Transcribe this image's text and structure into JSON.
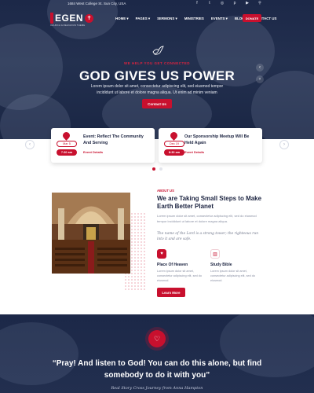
{
  "topbar": {
    "address": "1684 West College St. Sun City, USA",
    "social_icons": [
      "facebook-icon",
      "twitter-icon",
      "instagram-icon",
      "pinterest-icon",
      "youtube-icon",
      "search-icon"
    ],
    "social_glyphs": [
      "f",
      "t",
      "◎",
      "p",
      "▶",
      "⚲"
    ]
  },
  "brand": {
    "name": "EGEN",
    "tagline": "CHURCH & RELIGIOUS THEME"
  },
  "nav": {
    "items": [
      "HOME ▾",
      "PAGES ▾",
      "SERMONS ▾",
      "MINISTRIES",
      "EVENTS ▾",
      "BLOG ▾",
      "CONTACT US"
    ],
    "donate": "DONATE"
  },
  "hero": {
    "pre_title": "WE HELP YOU GET CONNECTED",
    "title": "GOD GIVES US POWER",
    "subtitle": "Lorem ipsum dolor sit amet, consectetur adipiscing elit, sed eiusmod tempor incididunt ut labore et dolore magna aliqua. Ut enim ad minim veniam",
    "button": "Contact Us",
    "arrow_up": "‹",
    "arrow_down": "›"
  },
  "events": [
    {
      "date": "Mar 5",
      "time": "7:30 am",
      "title": "Event: Reflect The Community And Serving",
      "link": "Event Details"
    },
    {
      "date": "Dec 19",
      "time": "8:30 am",
      "title": "Our Sponsorship Meetup Will Be Held Again",
      "link": "Event Details"
    }
  ],
  "events_nav": {
    "prev": "‹",
    "next": "›"
  },
  "about": {
    "tag": "ABOUT US",
    "title": "We are Taking Small Steps to Make Earth Better Planet",
    "body": "Lorem ipsum dolor sit amet, consectetur adipiscing elit, sed do eiusmod tempor incididunt ut labore et dolore magna aliqua.",
    "quote": "The name of the Lord is a strong tower; the righteous run into it and are safe.",
    "features": [
      {
        "icon": "heart-icon",
        "title": "Place Of Heaven",
        "body": "Lorem ipsum dolor sit amet, consectetur adipiscing elit, sed do eiusmod."
      },
      {
        "icon": "bible-icon",
        "title": "Study Bible",
        "body": "Lorem ipsum dolor sit amet, consectetur adipiscing elit, sed do eiusmod."
      }
    ],
    "button": "Learn More"
  },
  "testimonial": {
    "quote": "“Pray! And listen to God! You can do this alone, but find somebody to do it with you”",
    "author": "Real Story Cross Journey from Anna Hampton"
  },
  "colors": {
    "accent": "#c8102e",
    "navy": "#1c2848"
  }
}
